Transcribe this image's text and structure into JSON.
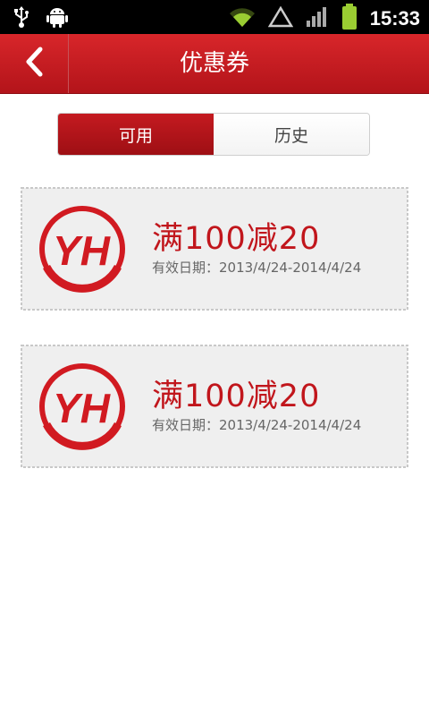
{
  "status_bar": {
    "time": "15:33",
    "icons": [
      "usb-icon",
      "android-debug-icon",
      "wifi-icon",
      "signal-alert-icon",
      "cell-signal-icon",
      "battery-icon"
    ]
  },
  "header": {
    "title": "优惠券",
    "back_icon": "chevron-left-icon"
  },
  "tabs": [
    {
      "label": "可用",
      "active": true
    },
    {
      "label": "历史",
      "active": false
    }
  ],
  "coupons": [
    {
      "logo_text": "YH",
      "title": "满100减20",
      "date_label": "有效日期：2013/4/24-2014/4/24"
    },
    {
      "logo_text": "YH",
      "title": "满100减20",
      "date_label": "有效日期：2013/4/24-2014/4/24"
    }
  ],
  "colors": {
    "brand_red": "#c1161c",
    "card_bg": "#efefef",
    "card_border": "#cccccc"
  }
}
